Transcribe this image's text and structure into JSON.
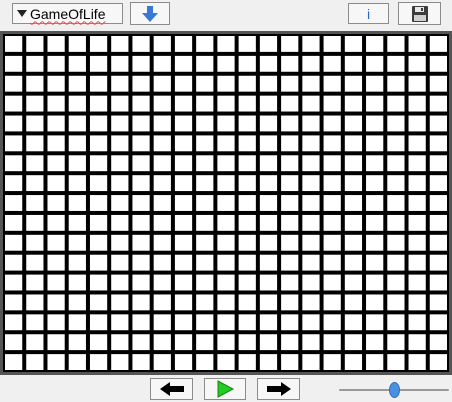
{
  "toolbar": {
    "model_select_label": "GameOfLife",
    "download_icon": "download-arrow-icon",
    "info_label": "i",
    "save_icon": "floppy-disk-icon"
  },
  "grid": {
    "columns": 21,
    "rows": 17,
    "cell_color": "#ffffff",
    "line_color": "#000000",
    "frame_color": "#555555"
  },
  "controls": {
    "back_icon": "arrow-left-icon",
    "play_icon": "play-icon",
    "forward_icon": "arrow-right-icon",
    "play_color": "#22cc22"
  },
  "speed_slider": {
    "value": 0.5
  }
}
